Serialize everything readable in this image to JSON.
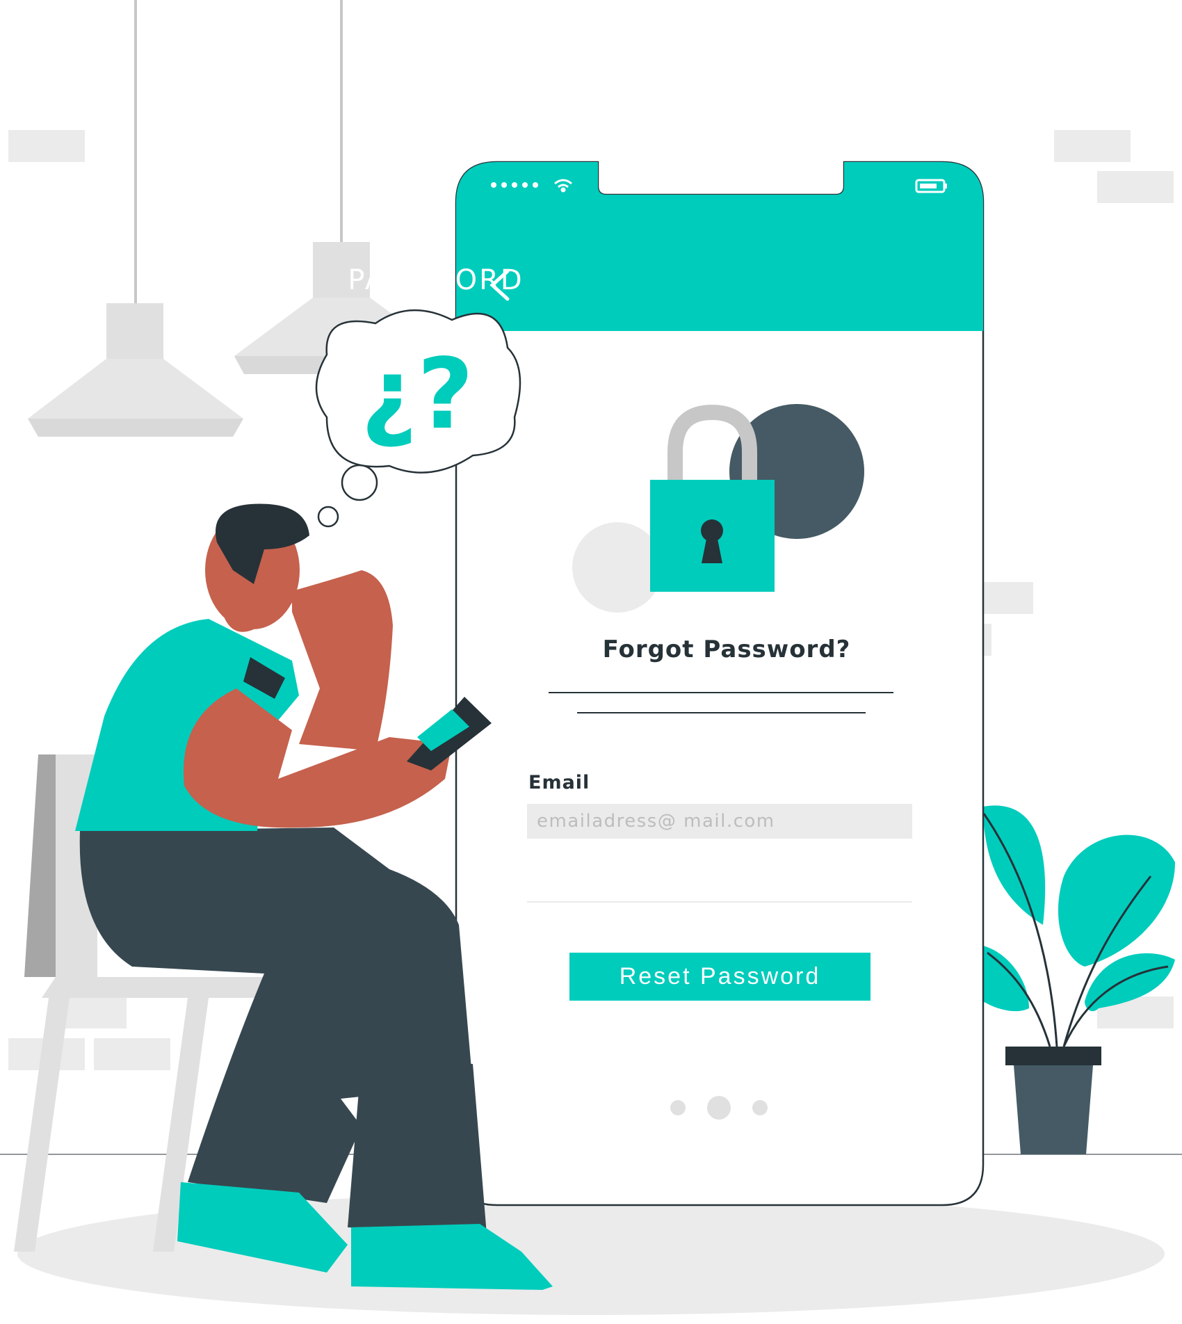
{
  "header": {
    "title": "PASSWORD",
    "back_icon": "chevron-left-icon",
    "status_icons": [
      "signal-dots-icon",
      "wifi-icon",
      "battery-icon"
    ]
  },
  "main": {
    "lock_icon": "padlock-icon",
    "heading": "Forgot Password?",
    "email_label": "Email",
    "email_placeholder": "emailadress@ mail.com",
    "reset_button": "Reset Password",
    "pagination": {
      "pages": 3,
      "active": 2
    }
  },
  "illustration": {
    "thought_bubble_text": "¿?"
  },
  "colors": {
    "accent": "#00ccbc",
    "dark": "#263238",
    "dark_alt": "#455a64",
    "skin": "#c5614d",
    "light_gray": "#ebebeb",
    "mid_gray": "#e0e0e0"
  }
}
